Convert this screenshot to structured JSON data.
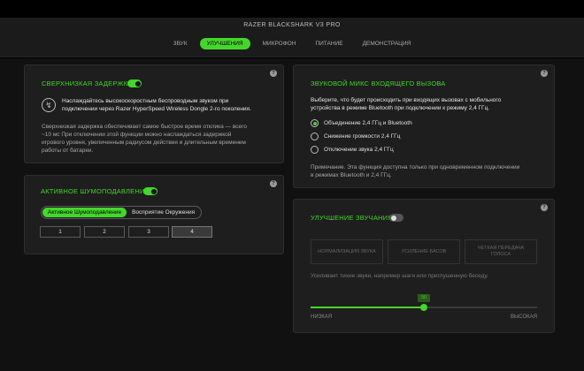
{
  "window": {
    "title": "RAZER BLACKSHARK V3 PRO"
  },
  "tabs": [
    {
      "label": "ЗВУК",
      "active": false
    },
    {
      "label": "УЛУЧШЕНИЯ",
      "active": true
    },
    {
      "label": "МИКРОФОН",
      "active": false
    },
    {
      "label": "ПИТАНИЕ",
      "active": false
    },
    {
      "label": "ДЕМОНСТРАЦИЯ",
      "active": false
    }
  ],
  "help_glyph": "?",
  "latency": {
    "title": "СВЕРХНИЗКАЯ ЗАДЕРЖКА",
    "enabled": true,
    "dongle_line1": "Наслаждайтесь высокоскоростным беспроводным звуком при",
    "dongle_line2": "подключении через Razer HyperSpeed Wireless Dongle 2-го поколения.",
    "desc_line1": "Сверхнизкая задержка обеспечивает самое быстрое время отклика — всего",
    "desc_line2": "~10 мс При отключении этой функции можно наслаждаться задержкой",
    "desc_line3": "игрового уровня, увеличенным радиусом действия и длительным временем",
    "desc_line4": "работы от батареи."
  },
  "anc": {
    "title": "АКТИВНОЕ ШУМОПОДАВЛЕНИЕ",
    "enabled": true,
    "modes": [
      "Активное Шумоподавление",
      "Восприятие Окружения"
    ],
    "selected_mode": 0,
    "levels": [
      "1",
      "2",
      "3",
      "4"
    ],
    "selected_level": 3
  },
  "call_mix": {
    "title": "ЗВУКОВОЙ МИКС ВХОДЯЩЕГО ВЫЗОВА",
    "desc_line1": "Выберите, что будет происходить при входящих вызовах с мобильного",
    "desc_line2": "устройства в режиме Bluetooth при подключении к режиму 2,4 ГГц.",
    "options": [
      "Объединение 2,4 ГГц и Bluetooth",
      "Снижение громкости 2,4 ГГц",
      "Отключение звука 2,4 ГГц"
    ],
    "selected": 0,
    "note_line1": "Примечание. Эта функция доступна только при одновременном подключении",
    "note_line2": "в режимах Bluetooth и 2,4 ГГц."
  },
  "enhance": {
    "title": "УЛУЧШЕНИЕ ЗВУЧАНИЯ",
    "enabled": false,
    "buttons": {
      "normalize": "НОРМАЛИЗАЦИЯ ЗВУКА",
      "bass": "УСИЛЕНИЕ БАСОВ",
      "clarity_line1": "ЧЕТКАЯ ПЕРЕДАЧА",
      "clarity_line2": "ГОЛОСА"
    },
    "desc": "Усиливает тихие звуки, например шаги или приглушенную беседу.",
    "slider": {
      "value": 50,
      "min": 0,
      "max": 100,
      "value_label": "50",
      "low_label": "НИЗКАЯ",
      "high_label": "ВЫСОКАЯ"
    }
  },
  "colors": {
    "accent": "#44d62c",
    "panel": "#1e1e1e",
    "background": "#111111"
  }
}
